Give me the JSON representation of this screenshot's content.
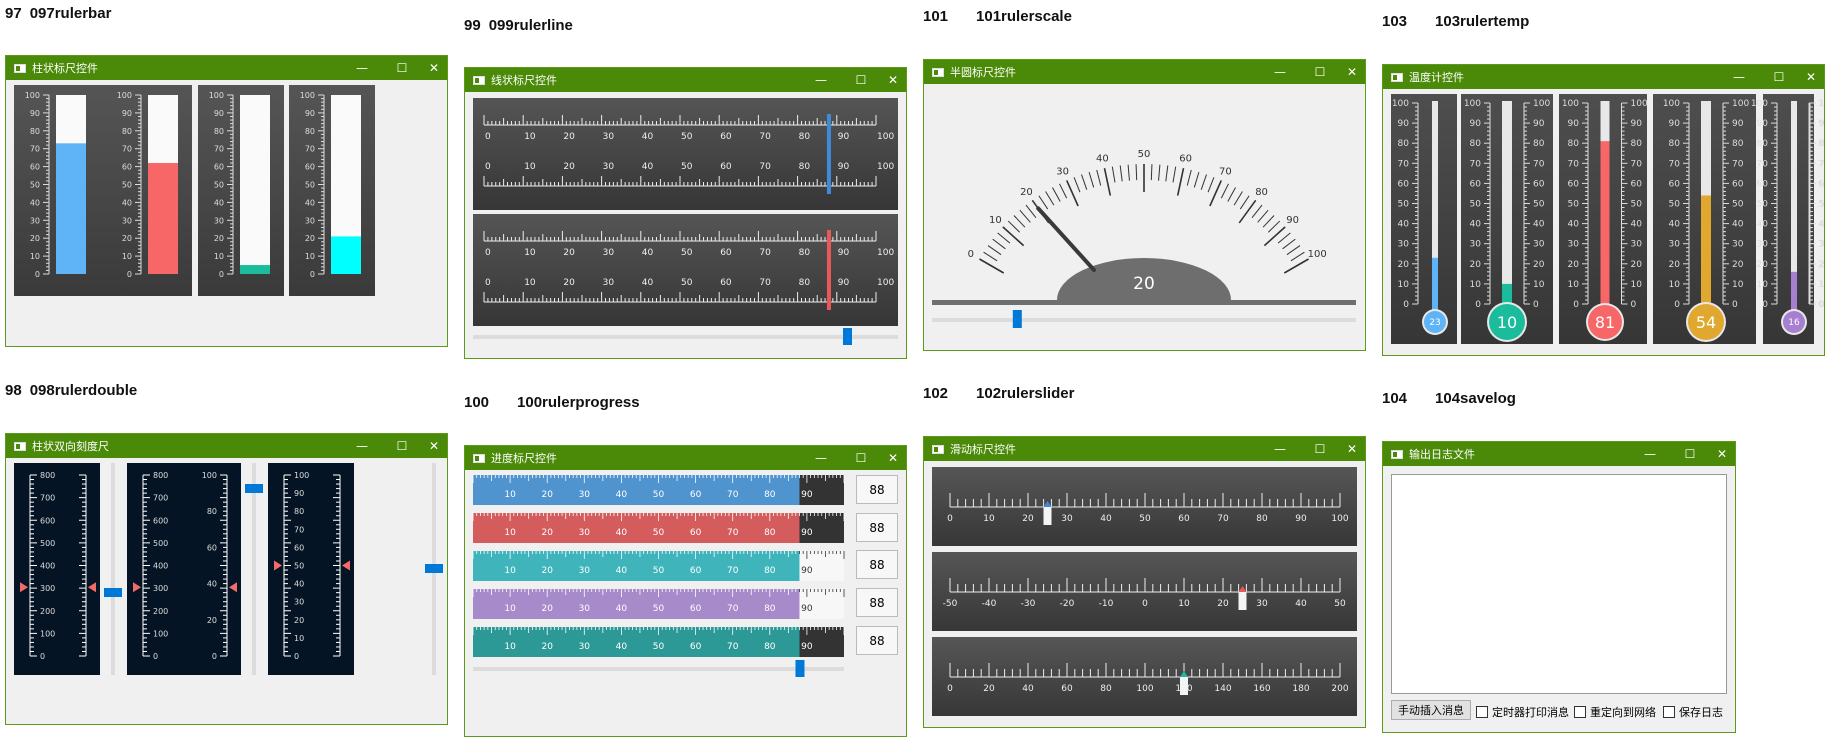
{
  "labels": [
    {
      "num": "97",
      "text": "097rulerbar"
    },
    {
      "num": "98",
      "text": "098rulerdouble"
    },
    {
      "num": "99",
      "text": "099rulerline"
    },
    {
      "num": "100",
      "text": "100rulerprogress"
    },
    {
      "num": "101",
      "text": "101rulerscale"
    },
    {
      "num": "102",
      "text": "102rulerslider"
    },
    {
      "num": "103",
      "text": "103rulertemp"
    },
    {
      "num": "104",
      "text": "104savelog"
    }
  ],
  "window_buttons": {
    "minimize": "—",
    "maximize": "☐",
    "close": "✕"
  },
  "windows": {
    "rulerbar": {
      "title": "柱状标尺控件"
    },
    "rulerdouble": {
      "title": "柱状双向刻度尺"
    },
    "rulerline": {
      "title": "线状标尺控件"
    },
    "rulerprogress": {
      "title": "进度标尺控件"
    },
    "rulerscale": {
      "title": "半圆标尺控件"
    },
    "rulerslider": {
      "title": "滑动标尺控件"
    },
    "rulertemp": {
      "title": "温度计控件"
    },
    "savelog": {
      "title": "输出日志文件"
    }
  },
  "colors": {
    "titlebar": "#4b8a08",
    "slider": "#0078d7",
    "panel_dark": "#3e3e3e"
  },
  "rulerbar": {
    "ticks": [
      "0",
      "10",
      "20",
      "30",
      "40",
      "50",
      "60",
      "70",
      "80",
      "90",
      "100"
    ],
    "bars": [
      {
        "value": 73,
        "color": "#5fb4f7"
      },
      {
        "value": 62,
        "color": "#f86767"
      },
      {
        "value": 5,
        "color": "#1abc9c"
      },
      {
        "value": 21,
        "color": "#00ffff"
      }
    ]
  },
  "rulerdouble": {
    "ticks_big": [
      "0",
      "100",
      "200",
      "300",
      "400",
      "500",
      "600",
      "700",
      "800"
    ],
    "ticks_left2": [
      "0",
      "100",
      "200",
      "300",
      "400",
      "500",
      "600",
      "700",
      "800"
    ],
    "ticks_right2": [
      "0",
      "20",
      "40",
      "60",
      "80",
      "100"
    ],
    "ticks_small": [
      "0",
      "10",
      "20",
      "30",
      "40",
      "50",
      "60",
      "70",
      "80",
      "90",
      "100"
    ],
    "rulers": [
      {
        "value_fraction": 0.38
      },
      {
        "value_fraction": 0.38
      },
      {
        "value_fraction": 0.5
      }
    ],
    "sliders": [
      0.38,
      0.9,
      0.5
    ]
  },
  "rulerline": {
    "ticks": [
      "0",
      "10",
      "20",
      "30",
      "40",
      "50",
      "60",
      "70",
      "80",
      "90",
      "100"
    ],
    "panels": [
      {
        "value": 88,
        "color": "#3d8bd9"
      },
      {
        "value": 88,
        "color": "#e85a5a"
      }
    ],
    "slider": 0.88
  },
  "rulerprogress": {
    "ticks": [
      "10",
      "20",
      "30",
      "40",
      "50",
      "60",
      "70",
      "80",
      "90"
    ],
    "rows": [
      {
        "value": 88,
        "color": "#4f93cf",
        "rest": "#333333",
        "text": "88"
      },
      {
        "value": 88,
        "color": "#d45c5c",
        "rest": "#333333",
        "text": "88"
      },
      {
        "value": 88,
        "color": "#3fb5bb",
        "rest": "#f7f7f7",
        "text": "88"
      },
      {
        "value": 88,
        "color": "#a68ac9",
        "rest": "#f7f7f7",
        "text": "88"
      },
      {
        "value": 88,
        "color": "#2c9996",
        "rest": "#333333",
        "text": "88"
      }
    ],
    "slider": 0.88
  },
  "rulerscale": {
    "ticks": [
      "0",
      "10",
      "20",
      "30",
      "40",
      "50",
      "60",
      "70",
      "80",
      "90",
      "100"
    ],
    "value": 20,
    "value_text": "20",
    "slider": 0.2
  },
  "rulerslider": {
    "rows": [
      {
        "ticks": [
          "0",
          "10",
          "20",
          "30",
          "40",
          "50",
          "60",
          "70",
          "80",
          "90",
          "100"
        ],
        "min": 0,
        "max": 100,
        "value": 25,
        "color": "#3d8bd9"
      },
      {
        "ticks": [
          "-50",
          "-40",
          "-30",
          "-20",
          "-10",
          "0",
          "10",
          "20",
          "30",
          "40",
          "50"
        ],
        "min": -50,
        "max": 50,
        "value": 25,
        "color": "#e85a5a"
      },
      {
        "ticks": [
          "0",
          "20",
          "40",
          "60",
          "80",
          "100",
          "120",
          "140",
          "160",
          "180",
          "200"
        ],
        "min": 0,
        "max": 200,
        "value": 120,
        "color": "#1abc9c"
      }
    ]
  },
  "rulertemp": {
    "ticks": [
      "0",
      "10",
      "20",
      "30",
      "40",
      "50",
      "60",
      "70",
      "80",
      "90",
      "100"
    ],
    "thermos": [
      {
        "value": 23,
        "text": "23",
        "color": "#5fb4f7"
      },
      {
        "value": 10,
        "text": "10",
        "color": "#1abc9c"
      },
      {
        "value": 81,
        "text": "81",
        "color": "#f86767"
      },
      {
        "value": 54,
        "text": "54",
        "color": "#e0a82e"
      },
      {
        "value": 16,
        "text": "16",
        "color": "#a67fd1"
      }
    ]
  },
  "savelog": {
    "button": "手动插入消息",
    "checks": [
      "定时器打印消息",
      "重定向到网络",
      "保存日志"
    ]
  }
}
